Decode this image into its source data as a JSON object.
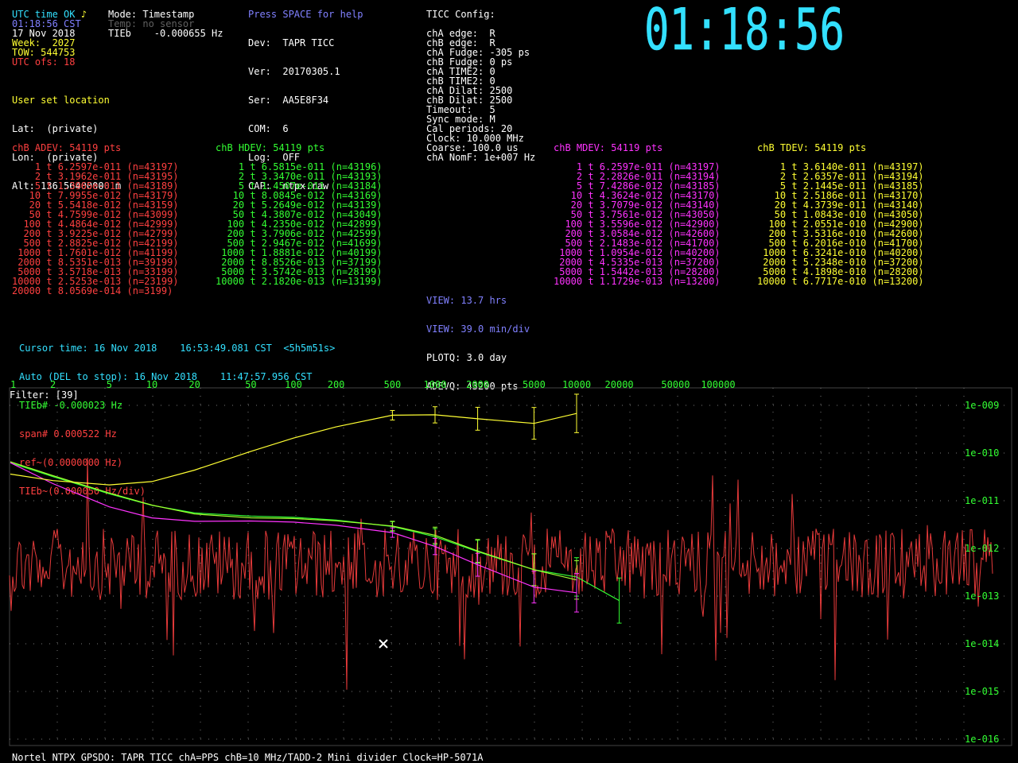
{
  "status": {
    "utc_status": "UTC time OK",
    "note_glyph": "♪",
    "mode_label": "Mode: Timestamp",
    "time_cst": "01:18:56 CST",
    "temp_label": "Temp: no sensor",
    "date": "17 Nov 2018",
    "tieb": "TIEb    -0.000655 Hz",
    "week": "Week:  2027",
    "tow": "TOW: 544753",
    "utc_ofs": "UTC ofs: 18"
  },
  "device": {
    "help": "Press SPACE for help",
    "dev": "Dev:  TAPR TICC",
    "ver": "Ver:  20170305.1",
    "ser": "Ser:  AA5E8F34",
    "com": "COM:  6",
    "log": "Log:  OFF",
    "cap": "CAP:  ntpx.raw"
  },
  "ticc_config": {
    "title": "TICC Config:",
    "lines": [
      "chA edge:  R",
      "chB edge:  R",
      "chA Fudge: -305 ps",
      "chB Fudge: 0 ps",
      "chA TIME2: 0",
      "chB TIME2: 0",
      "chA Dilat: 2500",
      "chB Dilat: 2500",
      "Timeout:   5",
      "Sync mode: M",
      "Cal periods: 20",
      "Clock: 10.000 MHz",
      "Coarse: 100.0 us",
      "chA NomF: 1e+007 Hz"
    ]
  },
  "big_clock": "01:18:56",
  "location": {
    "title": "User set location",
    "lat": "Lat:  (private)",
    "lon": "Lon:  (private)",
    "alt": "Alt: 136.56400000 m"
  },
  "adev": {
    "header": "chB ADEV: 54119 pts",
    "rows": [
      "    1 t 6.2597e-011 (n=43197)",
      "    2 t 3.1962e-011 (n=43195)",
      "    5 t 1.3965e-011 (n=43189)",
      "   10 t 7.9955e-012 (n=43179)",
      "   20 t 5.5418e-012 (n=43159)",
      "   50 t 4.7599e-012 (n=43099)",
      "  100 t 4.4864e-012 (n=42999)",
      "  200 t 3.9225e-012 (n=42799)",
      "  500 t 2.8825e-012 (n=42199)",
      " 1000 t 1.7601e-012 (n=41199)",
      " 2000 t 8.5351e-013 (n=39199)",
      " 5000 t 3.5718e-013 (n=33199)",
      "10000 t 2.5253e-013 (n=23199)",
      "20000 t 8.0569e-014 (n=3199)"
    ]
  },
  "hdev": {
    "header": "chB HDEV: 54119 pts",
    "rows": [
      "    1 t 6.5815e-011 (n=43196)",
      "    2 t 3.3470e-011 (n=43193)",
      "    5 t 1.4507e-011 (n=43184)",
      "   10 t 8.0845e-012 (n=43169)",
      "   20 t 5.2649e-012 (n=43139)",
      "   50 t 4.3807e-012 (n=43049)",
      "  100 t 4.2350e-012 (n=42899)",
      "  200 t 3.7906e-012 (n=42599)",
      "  500 t 2.9467e-012 (n=41699)",
      " 1000 t 1.8881e-012 (n=40199)",
      " 2000 t 8.8526e-013 (n=37199)",
      " 5000 t 3.5742e-013 (n=28199)",
      "10000 t 2.1820e-013 (n=13199)"
    ]
  },
  "mdev": {
    "header": "chB MDEV: 54119 pts",
    "rows": [
      "    1 t 6.2597e-011 (n=43197)",
      "    2 t 2.2826e-011 (n=43194)",
      "    5 t 7.4286e-012 (n=43185)",
      "   10 t 4.3624e-012 (n=43170)",
      "   20 t 3.7079e-012 (n=43140)",
      "   50 t 3.7561e-012 (n=43050)",
      "  100 t 3.5596e-012 (n=42900)",
      "  200 t 3.0584e-012 (n=42600)",
      "  500 t 2.1483e-012 (n=41700)",
      " 1000 t 1.0954e-012 (n=40200)",
      " 2000 t 4.5335e-013 (n=37200)",
      " 5000 t 1.5442e-013 (n=28200)",
      "10000 t 1.1729e-013 (n=13200)"
    ]
  },
  "tdev": {
    "header": "chB TDEV: 54119 pts",
    "rows": [
      "    1 t 3.6140e-011 (n=43197)",
      "    2 t 2.6357e-011 (n=43194)",
      "    5 t 2.1445e-011 (n=43185)",
      "   10 t 2.5186e-011 (n=43170)",
      "   20 t 4.3739e-011 (n=43140)",
      "   50 t 1.0843e-010 (n=43050)",
      "  100 t 2.0551e-010 (n=42900)",
      "  200 t 3.5316e-010 (n=42600)",
      "  500 t 6.2016e-010 (n=41700)",
      " 1000 t 6.3241e-010 (n=40200)",
      " 2000 t 5.2348e-010 (n=37200)",
      " 5000 t 4.1898e-010 (n=28200)",
      "10000 t 6.7717e-010 (n=13200)"
    ]
  },
  "view": {
    "view_hrs": "VIEW: 13.7 hrs",
    "view_div": "VIEW: 39.0 min/div",
    "plotq": "PLOTQ: 3.0 day",
    "adevq": "ADEVQ: 43200 pts"
  },
  "cursor": {
    "cursor_time": "Cursor time: 16 Nov 2018    16:53:49.081 CST  <5h5m51s>",
    "auto": "Auto (DEL to stop): 16 Nov 2018    11:47:57.956 CST",
    "tieb": "TIEb# -0.000023 Hz",
    "span": "span# 0.000522 Hz",
    "ref": "ref~(0.0000000 Hz)",
    "tieb_div": "TIEb~(0.000050 Hz/div)"
  },
  "plot": {
    "filter": "Filter: [39]",
    "tau_labels": [
      "1",
      "2",
      "5",
      "10",
      "20",
      "50",
      "100",
      "200",
      "500",
      "1000",
      "2000",
      "5000",
      "10000",
      "20000",
      "50000",
      "100000"
    ],
    "y_labels": [
      "1e-009",
      "1e-010",
      "1e-011",
      "1e-012",
      "1e-013",
      "1e-014",
      "1e-015",
      "1e-016"
    ],
    "footer": "Nortel NTPX GPSDO:  TAPR TICC  chA=PPS   chB=10 MHz/TADD-2 Mini divider   Clock=HP-5071A"
  },
  "chart_data": {
    "type": "line",
    "xlabel": "",
    "ylabel": "",
    "x_scale": "log",
    "y_scale": "log",
    "x": [
      1,
      2,
      5,
      10,
      20,
      50,
      100,
      200,
      500,
      1000,
      2000,
      5000,
      10000,
      20000
    ],
    "ylim": [
      1e-16,
      1e-09
    ],
    "series": [
      {
        "name": "chB ADEV",
        "color": "#33ff33",
        "values": [
          6.2597e-11,
          3.1962e-11,
          1.3965e-11,
          7.9955e-12,
          5.5418e-12,
          4.7599e-12,
          4.4864e-12,
          3.9225e-12,
          2.8825e-12,
          1.7601e-12,
          8.5351e-13,
          3.5718e-13,
          2.5253e-13,
          8.0569e-14
        ]
      },
      {
        "name": "chB HDEV",
        "color": "#a0ff30",
        "values": [
          6.5815e-11,
          3.347e-11,
          1.4507e-11,
          8.0845e-12,
          5.2649e-12,
          4.3807e-12,
          4.235e-12,
          3.7906e-12,
          2.9467e-12,
          1.8881e-12,
          8.8526e-13,
          3.5742e-13,
          2.182e-13
        ]
      },
      {
        "name": "chB MDEV",
        "color": "#ff33ff",
        "values": [
          6.2597e-11,
          2.2826e-11,
          7.4286e-12,
          4.3624e-12,
          3.7079e-12,
          3.7561e-12,
          3.5596e-12,
          3.0584e-12,
          2.1483e-12,
          1.0954e-12,
          4.5335e-13,
          1.5442e-13,
          1.1729e-13
        ]
      },
      {
        "name": "chB TDEV",
        "color": "#ffff33",
        "values": [
          3.614e-11,
          2.6357e-11,
          2.1445e-11,
          2.5186e-11,
          4.3739e-11,
          1.0843e-10,
          2.0551e-10,
          3.5316e-10,
          6.2016e-10,
          6.3241e-10,
          5.2348e-10,
          4.1898e-10,
          6.7717e-10
        ]
      }
    ],
    "tie_trace_color": "#ff4040",
    "grid": true
  }
}
